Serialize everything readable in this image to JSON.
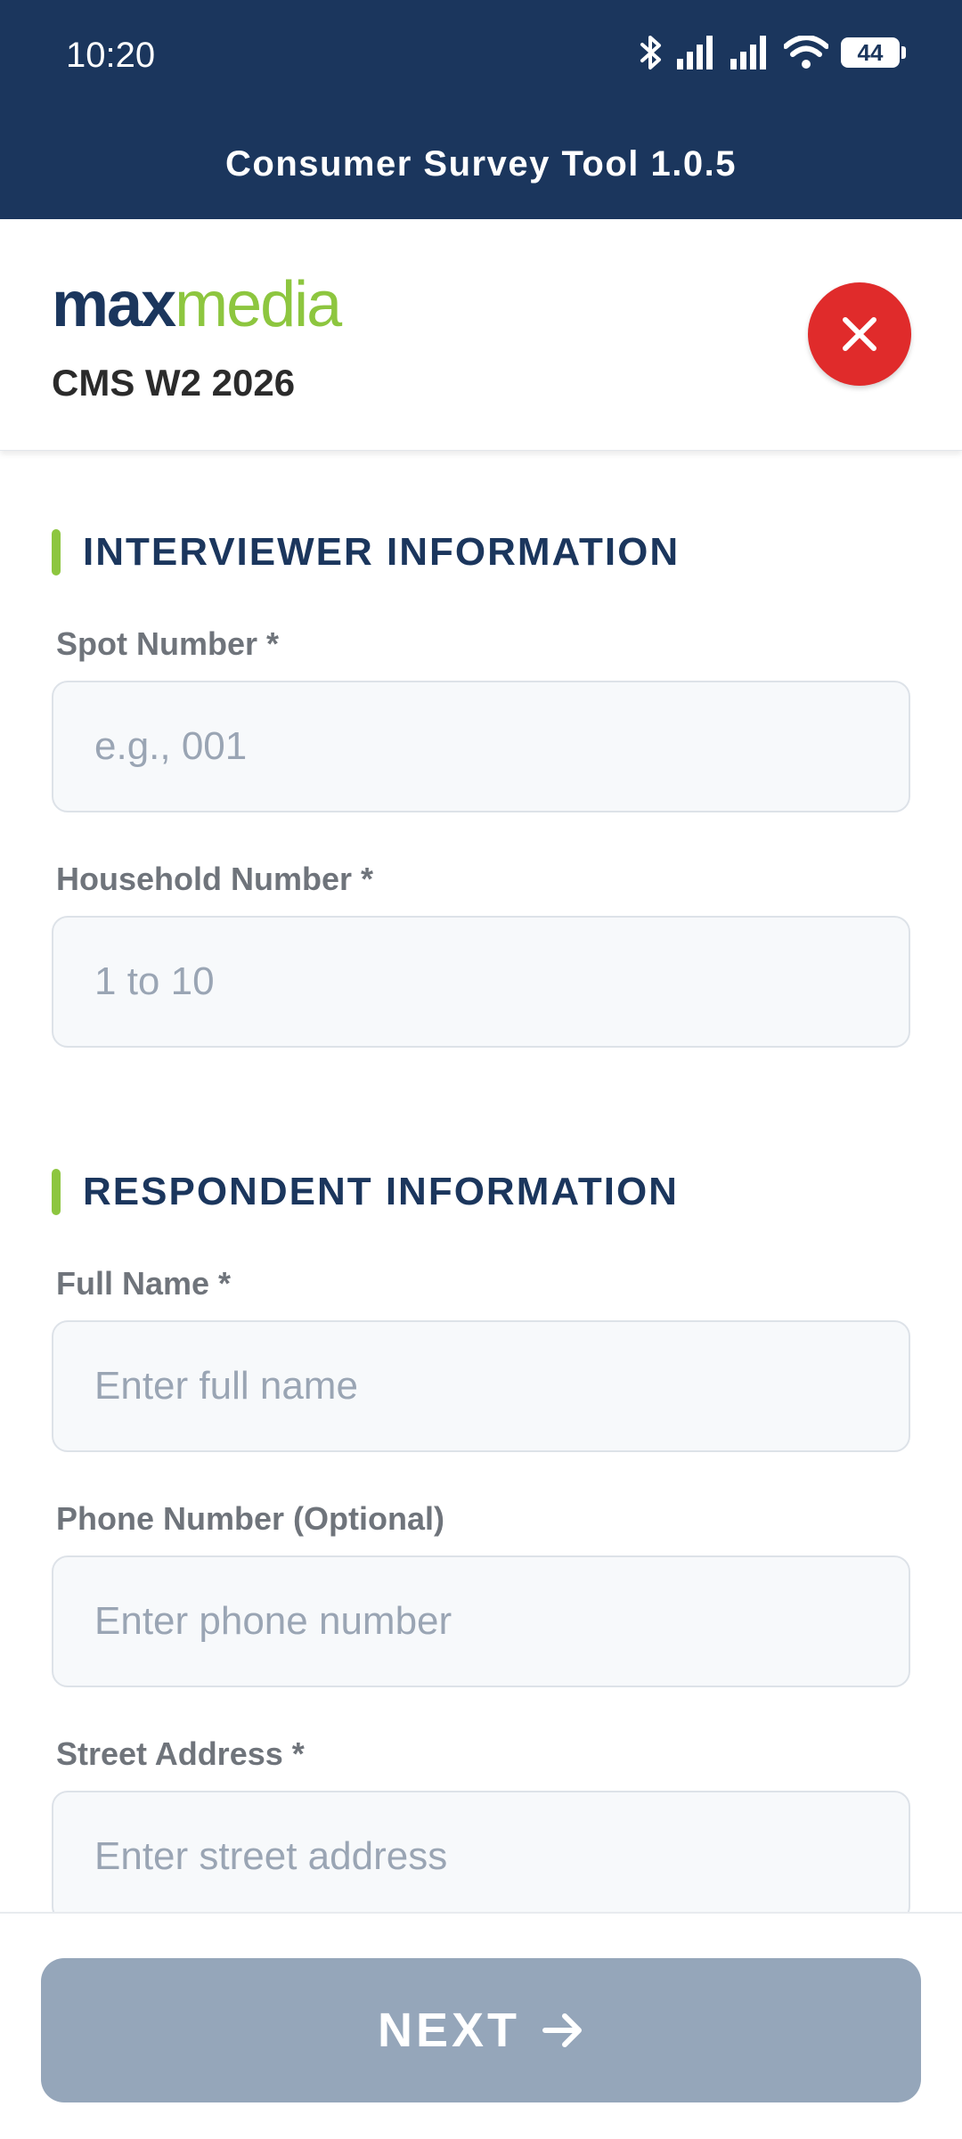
{
  "status_bar": {
    "time": "10:20",
    "battery": "44",
    "icons": [
      "bluetooth-icon",
      "signal-icon",
      "signal-icon",
      "wifi-icon",
      "battery-icon"
    ]
  },
  "app": {
    "title": "Consumer Survey Tool 1.0.5"
  },
  "header": {
    "logo_max": "max",
    "logo_media": "media",
    "project": "CMS W2 2026",
    "close_icon": "close-icon"
  },
  "sections": {
    "interviewer": {
      "title": "INTERVIEWER INFORMATION",
      "spot_number": {
        "label": "Spot Number *",
        "placeholder": "e.g., 001",
        "value": ""
      },
      "household_number": {
        "label": "Household Number *",
        "placeholder": "1 to 10",
        "value": ""
      }
    },
    "respondent": {
      "title": "RESPONDENT INFORMATION",
      "full_name": {
        "label": "Full Name *",
        "placeholder": "Enter full name",
        "value": ""
      },
      "phone_number": {
        "label": "Phone Number (Optional)",
        "placeholder": "Enter phone number",
        "value": ""
      },
      "street_address": {
        "label": "Street Address *",
        "placeholder": "Enter street address",
        "value": ""
      }
    }
  },
  "footer": {
    "next_label": "NEXT",
    "next_icon": "arrow-right-icon"
  },
  "colors": {
    "primary": "#1b365d",
    "accent": "#8dc63f",
    "danger": "#e02b2b",
    "disabled_button": "#95a6ba"
  }
}
